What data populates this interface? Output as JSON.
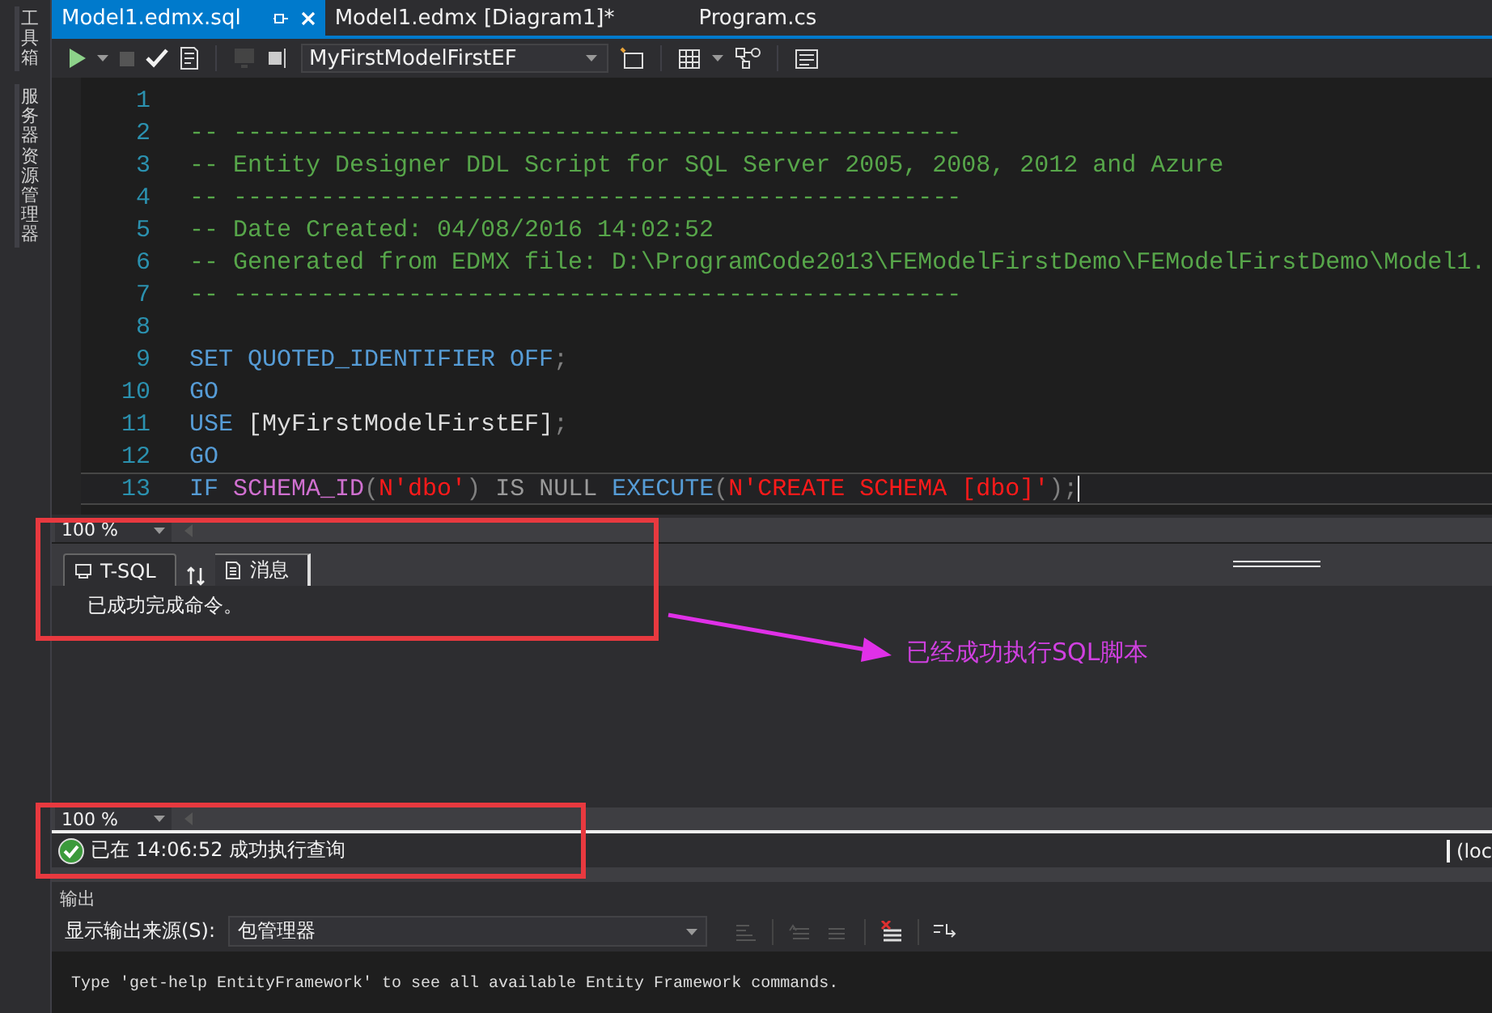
{
  "sidebar": {
    "tabs": [
      {
        "label": "工具箱"
      },
      {
        "label": "服务器资源管理器"
      }
    ]
  },
  "document_tabs": [
    {
      "label": "Model1.edmx.sql",
      "selected": true
    },
    {
      "label": "Model1.edmx [Diagram1]*",
      "selected": false
    },
    {
      "label": "Program.cs",
      "selected": false
    }
  ],
  "toolbar": {
    "database": "MyFirstModelFirstEF"
  },
  "editor": {
    "lines": [
      {
        "number": "1",
        "current": false
      },
      {
        "number": "2",
        "current": false,
        "tokens": [
          {
            "kind": "comment",
            "text": "-- --------------------------------------------------"
          }
        ]
      },
      {
        "number": "3",
        "current": false,
        "tokens": [
          {
            "kind": "comment",
            "text": "-- Entity Designer DDL Script for SQL Server 2005, 2008, 2012 and Azure"
          }
        ]
      },
      {
        "number": "4",
        "current": false,
        "tokens": [
          {
            "kind": "comment",
            "text": "-- --------------------------------------------------"
          }
        ]
      },
      {
        "number": "5",
        "current": false,
        "tokens": [
          {
            "kind": "comment",
            "text": "-- Date Created: 04/08/2016 14:02:52"
          }
        ]
      },
      {
        "number": "6",
        "current": false,
        "tokens": [
          {
            "kind": "comment",
            "text": "-- Generated from EDMX file: D:\\ProgramCode2013\\FEModelFirstDemo\\FEModelFirstDemo\\Model1."
          }
        ]
      },
      {
        "number": "7",
        "current": false,
        "tokens": [
          {
            "kind": "comment",
            "text": "-- --------------------------------------------------"
          }
        ]
      },
      {
        "number": "8",
        "current": false
      },
      {
        "number": "9",
        "current": false,
        "tokens": [
          {
            "kind": "keyword",
            "text": "SET QUOTED_IDENTIFIER OFF"
          },
          {
            "kind": "punct",
            "text": ";"
          }
        ]
      },
      {
        "number": "10",
        "current": false,
        "tokens": [
          {
            "kind": "keyword",
            "text": "GO"
          }
        ]
      },
      {
        "number": "11",
        "current": false,
        "tokens": [
          {
            "kind": "keyword",
            "text": "USE "
          },
          {
            "kind": "plain",
            "text": "[MyFirstModelFirstEF]"
          },
          {
            "kind": "punct",
            "text": ";"
          }
        ]
      },
      {
        "number": "12",
        "current": false,
        "tokens": [
          {
            "kind": "keyword",
            "text": "GO"
          }
        ]
      },
      {
        "number": "13",
        "current": true,
        "tokens": [
          {
            "kind": "keyword",
            "text": "IF "
          },
          {
            "kind": "function",
            "text": "SCHEMA_ID"
          },
          {
            "kind": "punct",
            "text": "("
          },
          {
            "kind": "string",
            "text": "N'dbo'"
          },
          {
            "kind": "punct",
            "text": ") "
          },
          {
            "kind": "operator",
            "text": "IS NULL "
          },
          {
            "kind": "keyword",
            "text": "EXECUTE"
          },
          {
            "kind": "punct",
            "text": "("
          },
          {
            "kind": "string",
            "text": "N'CREATE SCHEMA [dbo]'"
          },
          {
            "kind": "punct",
            "text": ");"
          }
        ]
      }
    ]
  },
  "results_pane": {
    "zoom": "100 %",
    "tabs": [
      {
        "label": "T-SQL",
        "selected": false
      },
      {
        "label": "消息",
        "selected": true
      }
    ],
    "message": "已成功完成命令。"
  },
  "annotation": {
    "text": "已经成功执行SQL脚本"
  },
  "status": {
    "zoom": "100 %",
    "message": "已在 14:06:52 成功执行查询",
    "connection": "(loc"
  },
  "output_pane": {
    "title": "输出",
    "source_label": "显示输出来源(S):",
    "source": "包管理器",
    "text": "Type 'get-help EntityFramework' to see all available Entity Framework commands."
  }
}
